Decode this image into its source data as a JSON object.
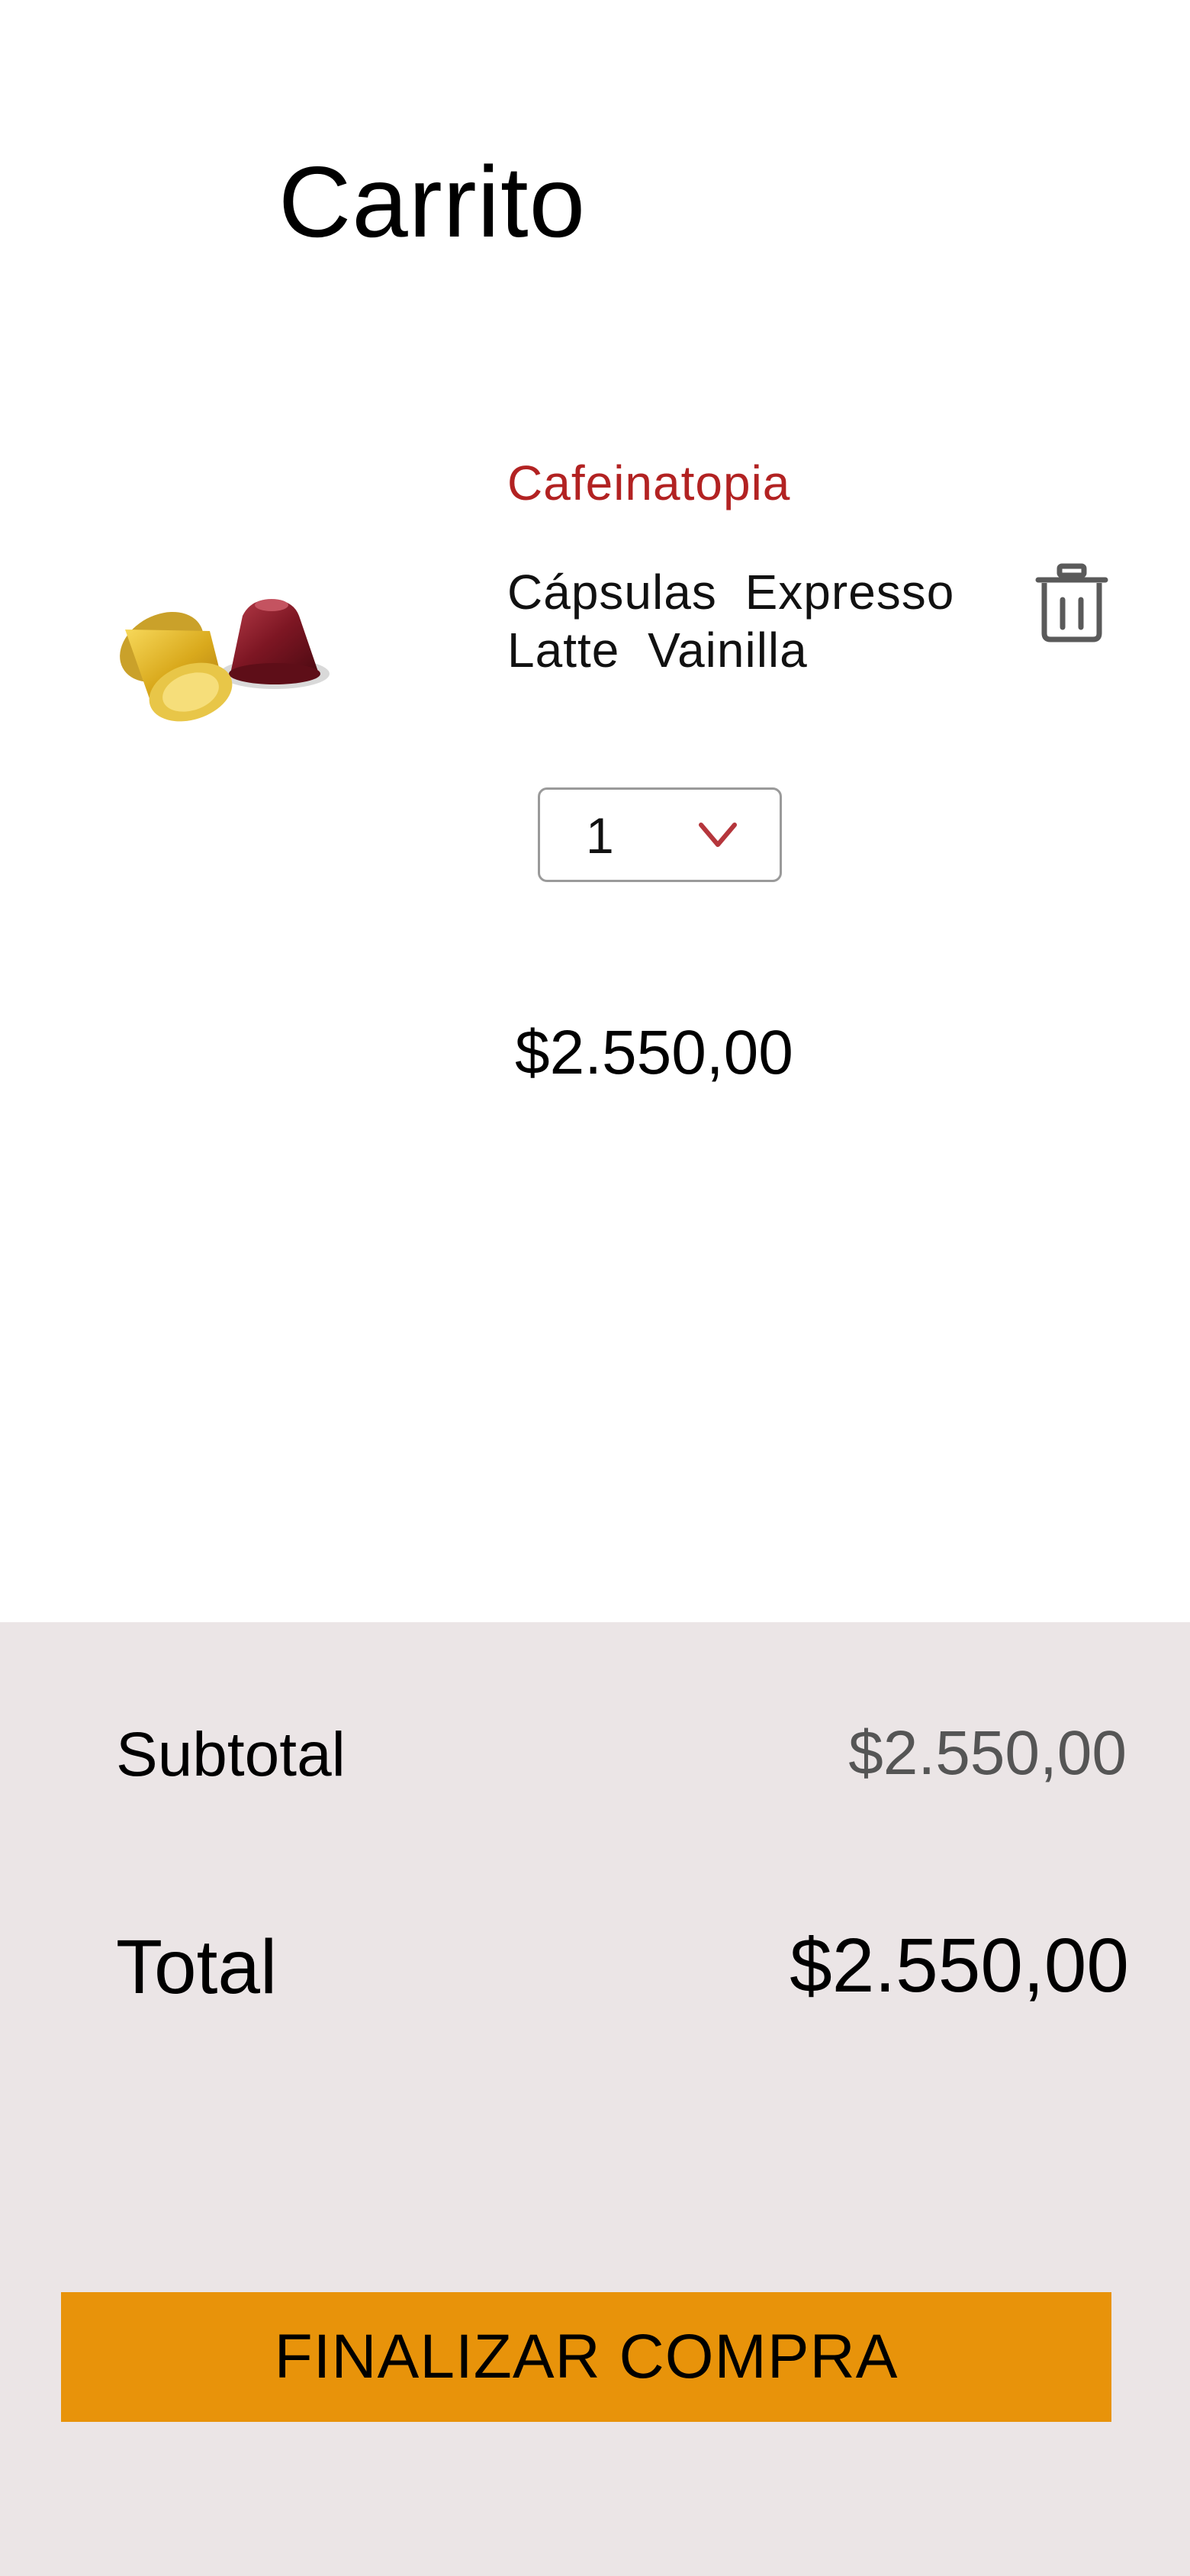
{
  "header": {
    "title": "Carrito"
  },
  "cart": {
    "items": [
      {
        "brand": "Cafeinatopia",
        "name": "Cápsulas  Expresso Latte Vainilla",
        "quantity": "1",
        "price": "$2.550,00",
        "image_icon": "coffee-capsules-image",
        "delete_icon": "trash-icon"
      }
    ]
  },
  "summary": {
    "subtotal_label": "Subtotal",
    "subtotal_value": "$2.550,00",
    "total_label": "Total",
    "total_value": "$2.550,00",
    "checkout_label": "FINALIZAR COMPRA"
  },
  "colors": {
    "brand_accent": "#b22222",
    "checkout_button": "#e8930a",
    "summary_background": "#ebe5e6",
    "chevron": "#b5363c"
  }
}
